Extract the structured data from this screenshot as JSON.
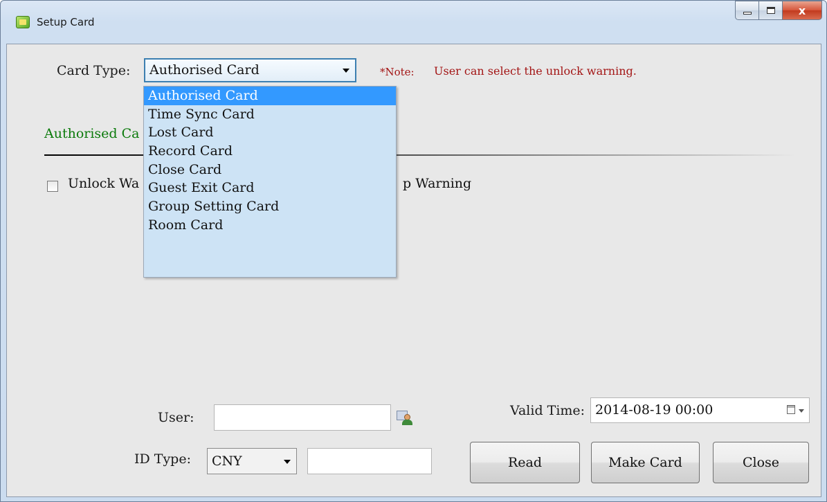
{
  "window": {
    "title": "Setup Card",
    "controls": {
      "minimize": "minimize",
      "maximize": "maximize",
      "close": "x"
    }
  },
  "form": {
    "card_type_label": "Card Type:",
    "card_type_selected": "Authorised Card",
    "note_label": "*Note:",
    "note_text": "User can select the unlock warning.",
    "card_type_options": [
      "Authorised Card",
      "Time Sync Card",
      "Lost Card",
      "Record Card",
      "Close Card",
      "Guest Exit Card",
      "Group Setting Card",
      "Room Card"
    ],
    "section_title": "Authorised Ca",
    "checkbox_left_label": "Unlock Wa",
    "checkbox_right_label": "p Warning",
    "user_label": "User:",
    "user_value": "",
    "id_type_label": "ID Type:",
    "id_type_selected": "CNY",
    "id_number_value": "",
    "valid_time_label": "Valid Time:",
    "valid_time_value": "2014-08-19 00:00"
  },
  "buttons": {
    "read": "Read",
    "make_card": "Make Card",
    "close": "Close"
  },
  "colors": {
    "note": "#a31515",
    "section_title": "#0b7a0b",
    "dropdown_selected": "#3399ff",
    "dropdown_bg": "#cde3f5"
  },
  "icons": {
    "app": "app-icon",
    "user_picker": "user-card-icon",
    "calendar": "calendar-icon"
  }
}
